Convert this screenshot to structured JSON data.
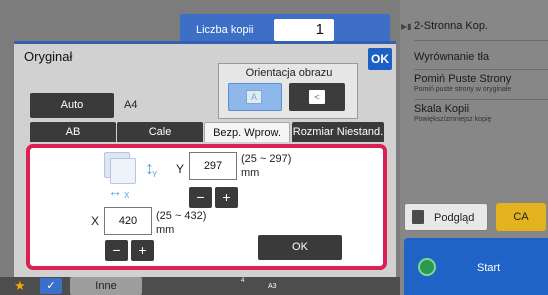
{
  "header": {
    "copies_label": "Liczba kopii",
    "copies_value": "1"
  },
  "right_panel": {
    "items": [
      {
        "title": "2-Stronna Kop.",
        "subtitle": ""
      },
      {
        "title": "Wyrównanie tła",
        "subtitle": ""
      },
      {
        "title": "Pomiń Puste Strony",
        "subtitle": "Pomiń puste strony w oryginale"
      },
      {
        "title": "Skala Kopii",
        "subtitle": "Powiększ/zmniejsz kopię"
      }
    ],
    "preview_label": "Podgląd",
    "ca_label": "CA",
    "start_label": "Start"
  },
  "bottom": {
    "other_label": "Inne",
    "tray_num": "4",
    "tray_size": "A3"
  },
  "dialog": {
    "title": "Oryginał",
    "ok_top_label": "OK",
    "orientation": {
      "label": "Orientacja obrazu"
    },
    "auto_label": "Auto",
    "auto_value": "A4",
    "tabs": [
      "AB",
      "Cale",
      "Bezp. Wprow.",
      "Rozmiar Niestand."
    ],
    "active_tab": "Bezp. Wprow.",
    "size": {
      "y_label": "Y",
      "y_value": "297",
      "y_range": "(25 ~ 297)",
      "x_label": "X",
      "x_value": "420",
      "x_range": "(25 ~ 432)",
      "unit": "mm",
      "minus": "−",
      "plus": "+",
      "arrow_y": "Y",
      "arrow_x": "X"
    },
    "ok_label": "OK"
  },
  "colors": {
    "highlight": "#dc1f55",
    "accent": "#1d5fc4",
    "ca": "#e5b21f"
  }
}
